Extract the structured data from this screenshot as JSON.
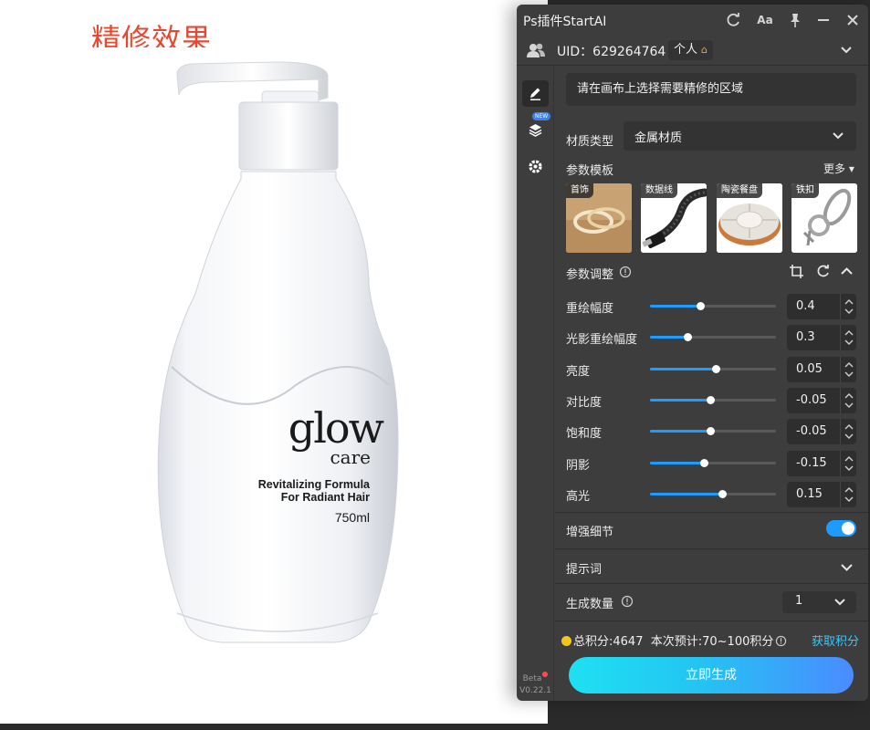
{
  "canvas": {
    "title": "精修效果",
    "product": {
      "brand_word": "glow",
      "brand_sub": "care",
      "line1": "Revitalizing Formula",
      "line2": "For Radiant Hair",
      "volume": "750ml"
    }
  },
  "panel": {
    "app_title": "Ps插件StartAI",
    "font_button": "Aa",
    "uid": "UID：629264764",
    "account_type": "个人",
    "new_badge": "NEW",
    "version_label": "Beta",
    "version": "V0.22.1",
    "hint": "请在画布上选择需要精修的区域",
    "material": {
      "label": "材质类型",
      "value": "金属材质"
    },
    "templates": {
      "label": "参数模板",
      "more": "更多",
      "items": [
        {
          "label": "首饰",
          "icon": "rings-thumbnail"
        },
        {
          "label": "数据线",
          "icon": "cable-thumbnail"
        },
        {
          "label": "陶瓷餐盘",
          "icon": "plate-thumbnail"
        },
        {
          "label": "铁扣",
          "icon": "buckle-thumbnail"
        }
      ]
    },
    "adjust": {
      "label": "参数调整",
      "sliders": [
        {
          "label": "重绘幅度",
          "value": "0.4",
          "fraction": 0.4
        },
        {
          "label": "光影重绘幅度",
          "value": "0.3",
          "fraction": 0.3
        },
        {
          "label": "亮度",
          "value": "0.05",
          "fraction": 0.525
        },
        {
          "label": "对比度",
          "value": "-0.05",
          "fraction": 0.475
        },
        {
          "label": "饱和度",
          "value": "-0.05",
          "fraction": 0.475
        },
        {
          "label": "阴影",
          "value": "-0.15",
          "fraction": 0.425
        },
        {
          "label": "高光",
          "value": "0.15",
          "fraction": 0.575
        }
      ]
    },
    "enhance_detail": {
      "label": "增强细节",
      "on": true
    },
    "prompt": {
      "label": "提示词"
    },
    "gen_count": {
      "label": "生成数量",
      "value": "1"
    },
    "points": {
      "total": "总积分:4647",
      "estimate": "本次预计:70~100积分"
    },
    "get_points": "获取积分",
    "generate": "立即生成",
    "accent_color": "#1e9bff"
  }
}
